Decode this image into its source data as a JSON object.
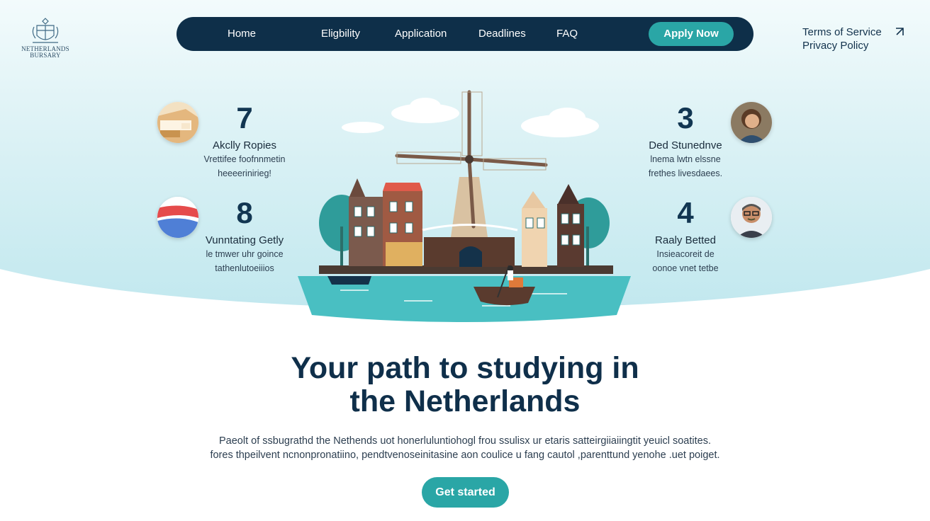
{
  "brand": {
    "logo_text": "NETHERLANDS BURSARY",
    "icon": "crest-icon"
  },
  "nav": {
    "items": [
      {
        "label": "Home"
      },
      {
        "label": "Eligbility"
      },
      {
        "label": "Application"
      },
      {
        "label": "Deadlines"
      },
      {
        "label": "FAQ"
      }
    ],
    "apply_label": "Apply Now"
  },
  "legal": {
    "terms": "Terms of Service",
    "privacy": "Privacy Policy",
    "icon": "arrow-icon"
  },
  "stats": [
    {
      "number": "7",
      "title": "Akclly Ropies",
      "desc1": "Vrettifee foofnnmetin",
      "desc2": "heeeerinirieg!",
      "icon": "wood-blocks-icon"
    },
    {
      "number": "8",
      "title": "Vunntating Getly",
      "desc1": "le tmwer uhr goince",
      "desc2": "tathenlutoeiiios",
      "icon": "stamp-icon"
    },
    {
      "number": "3",
      "title": "Ded Stunednve",
      "desc1": "lnema lwtn  elssne",
      "desc2": "frethes livesdaees.",
      "icon": "student-portrait-icon"
    },
    {
      "number": "4",
      "title": "Raaly Betted",
      "desc1": "Insieacoreit de",
      "desc2": "oonoe vnet tetbe",
      "icon": "advisor-portrait-icon"
    }
  ],
  "hero": {
    "headline_line1": "Your path to studying in",
    "headline_line2": "the Netherlands",
    "body_line1": "Paeolt of ssbugrathd the Nethends uot honerluluntiohogl frou ssulisx ur etaris satteirgiiaiingtit yeuicl soatites.",
    "body_line2": "fores thpeilvent ncnonpronatiino,  pendtvenoseinitasine aon coulice u fang cautol ,parenttund yenohe .uet poiget.",
    "cta_label": "Get started"
  },
  "colors": {
    "navy": "#0e2f49",
    "teal": "#2aa6a6",
    "sky": "#dff3f6"
  }
}
